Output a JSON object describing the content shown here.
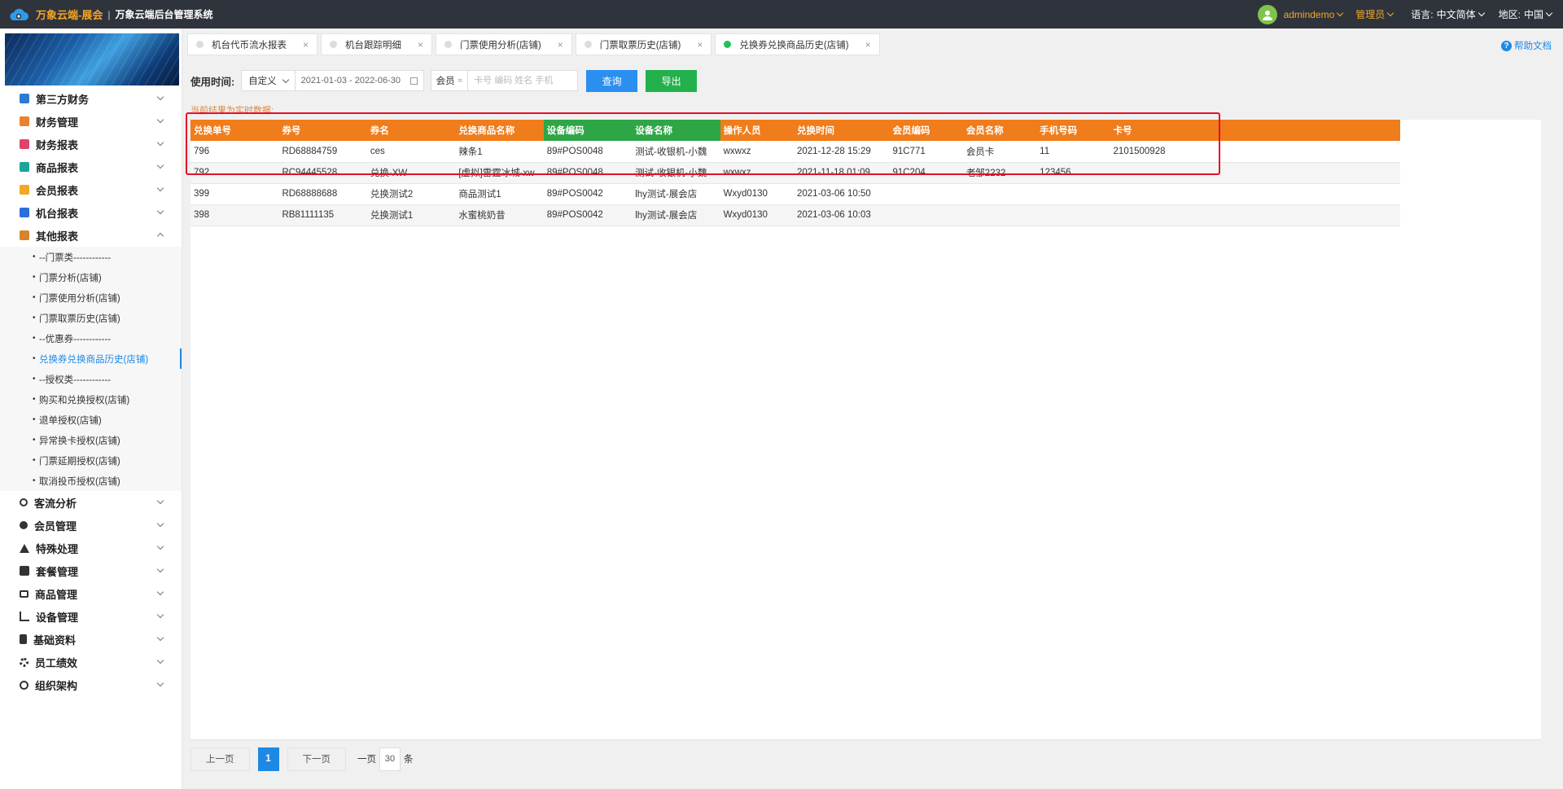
{
  "header": {
    "brand": "万象云端-展会",
    "separator": "|",
    "system_name": "万象云端后台管理系统",
    "user": "admindemo",
    "role": "管理员",
    "language_label": "语言:",
    "language_value": "中文简体",
    "region_label": "地区:",
    "region_value": "中国"
  },
  "sidebar": {
    "items": [
      {
        "label": "第三方财务",
        "icon_color": "#2b7bd6"
      },
      {
        "label": "财务管理",
        "icon_color": "#e8822e"
      },
      {
        "label": "财务报表",
        "icon_color": "#e0436a"
      },
      {
        "label": "商品报表",
        "icon_color": "#1aa59a"
      },
      {
        "label": "会员报表",
        "icon_color": "#f5a623"
      },
      {
        "label": "机台报表",
        "icon_color": "#2b6fdc"
      },
      {
        "label": "其他报表",
        "icon_color": "#d9822b"
      }
    ],
    "sub_items": [
      "--门票类------------",
      "门票分析(店铺)",
      "门票使用分析(店铺)",
      "门票取票历史(店铺)",
      "--优惠券------------",
      "兑换券兑换商品历史(店铺)",
      "--授权类------------",
      "购买和兑换授权(店铺)",
      "退单授权(店铺)",
      "异常换卡授权(店铺)",
      "门票延期授权(店铺)",
      "取消投币授权(店铺)"
    ],
    "items_after": [
      {
        "label": "客流分析"
      },
      {
        "label": "会员管理"
      },
      {
        "label": "特殊处理"
      },
      {
        "label": "套餐管理"
      },
      {
        "label": "商品管理"
      },
      {
        "label": "设备管理"
      },
      {
        "label": "基础资料"
      },
      {
        "label": "员工绩效"
      },
      {
        "label": "组织架构"
      }
    ]
  },
  "tabs": [
    {
      "label": "机台代币流水报表",
      "close": "×"
    },
    {
      "label": "机台跟踪明细",
      "close": "×"
    },
    {
      "label": "门票使用分析(店铺)",
      "close": "×"
    },
    {
      "label": "门票取票历史(店铺)",
      "close": "×"
    },
    {
      "label": "兑换券兑换商品历史(店铺)",
      "close": "×"
    }
  ],
  "help_label": "帮助文档",
  "filter": {
    "time_label": "使用时间:",
    "range_type": "自定义",
    "date_range": "2021-01-03 - 2022-06-30",
    "member_type": "会员",
    "member_placeholder": "卡号 编码 姓名 手机",
    "query_label": "查询",
    "export_label": "导出"
  },
  "realtime_note": "当前结果为实时数据:",
  "table": {
    "columns": [
      "兑换单号",
      "券号",
      "券名",
      "兑换商品名称",
      "设备编码",
      "设备名称",
      "操作人员",
      "兑换时间",
      "会员编码",
      "会员名称",
      "手机号码",
      "卡号"
    ],
    "rows": [
      [
        "796",
        "RD68884759",
        "ces",
        "辣条1",
        "89#POS0048",
        "测试-收银机-小魏",
        "wxwxz",
        "2021-12-28 15:29",
        "91C771",
        "会员卡",
        "11",
        "2101500928"
      ],
      [
        "792",
        "RC94445528",
        "兑换-XW",
        "[虚拟]雷霆冰城-xw",
        "89#POS0048",
        "测试-收银机-小魏",
        "wxwxz",
        "2021-11-18 01:09",
        "91C204",
        "老邹2232",
        "123456",
        ""
      ],
      [
        "399",
        "RD68888688",
        "兑换测试2",
        "商品测试1",
        "89#POS0042",
        "lhy测试-展会店",
        "Wxyd0130",
        "2021-03-06 10:50",
        "",
        "",
        "",
        ""
      ],
      [
        "398",
        "RB81111135",
        "兑换测试1",
        "水蜜桃奶昔",
        "89#POS0042",
        "lhy测试-展会店",
        "Wxyd0130",
        "2021-03-06 10:03",
        "",
        "",
        "",
        ""
      ]
    ]
  },
  "pagination": {
    "prev": "上一页",
    "current": "1",
    "next": "下一页",
    "size_label": "一页",
    "size": "30",
    "unit": "条"
  },
  "colors": {
    "header_orange": "#f07c1b",
    "header_green": "#2ea646",
    "highlight_red": "#e3102a",
    "accent_blue": "#1e88e5"
  }
}
